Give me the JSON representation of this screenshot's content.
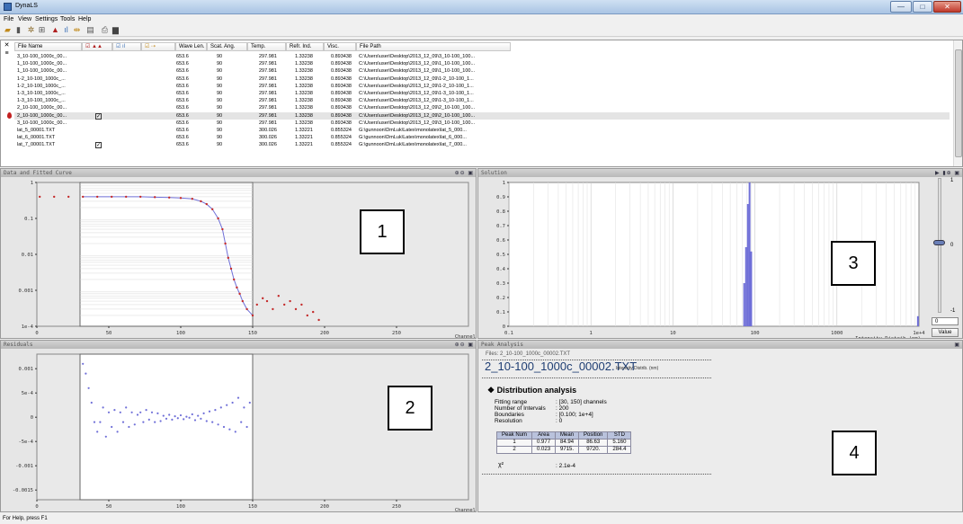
{
  "window": {
    "title": "DynaLS",
    "min": "—",
    "max": "□",
    "close": "✕"
  },
  "menu": [
    "File",
    "View",
    "Settings",
    "Tools",
    "Help"
  ],
  "toolbar_icons": [
    "open-icon",
    "delete-icon",
    "settings-icon",
    "fit-icon",
    "chart-icon",
    "axis-icon",
    "range-icon",
    "document-icon",
    "preview-icon",
    "print-icon"
  ],
  "table": {
    "headers": [
      "File Name",
      "☑ ▲▲",
      "☑ ıl",
      "☑ ⇢",
      "Wave Len.",
      "Scat. Ang.",
      "Temp.",
      "Refr. Ind.",
      "Visc.",
      "File Path"
    ],
    "rows": [
      {
        "name": "3_10-100_1000c_00...",
        "wave": "653.6",
        "angle": "90",
        "temp": "297.981",
        "refr": "1.33238",
        "visc": "0.893438",
        "path": "C:\\Users\\user\\Desktop\\2013_12_09\\3_10-100_100...",
        "checked": false,
        "selected": false,
        "active": false
      },
      {
        "name": "1_10-100_1000c_00...",
        "wave": "653.6",
        "angle": "90",
        "temp": "297.981",
        "refr": "1.33238",
        "visc": "0.893438",
        "path": "C:\\Users\\user\\Desktop\\2013_12_09\\1_10-100_100...",
        "checked": false,
        "selected": false,
        "active": false
      },
      {
        "name": "1_10-100_1000c_00...",
        "wave": "653.6",
        "angle": "90",
        "temp": "297.981",
        "refr": "1.33238",
        "visc": "0.893438",
        "path": "C:\\Users\\user\\Desktop\\2013_12_09\\1_10-100_100...",
        "checked": false,
        "selected": false,
        "active": false
      },
      {
        "name": "1-2_10-100_1000c_...",
        "wave": "653.6",
        "angle": "90",
        "temp": "297.981",
        "refr": "1.33238",
        "visc": "0.893438",
        "path": "C:\\Users\\user\\Desktop\\2013_12_09\\1-2_10-100_1...",
        "checked": false,
        "selected": false,
        "active": false
      },
      {
        "name": "1-2_10-100_1000c_...",
        "wave": "653.6",
        "angle": "90",
        "temp": "297.981",
        "refr": "1.33238",
        "visc": "0.893438",
        "path": "C:\\Users\\user\\Desktop\\2013_12_09\\1-2_10-100_1...",
        "checked": false,
        "selected": false,
        "active": false
      },
      {
        "name": "1-3_10-100_1000c_...",
        "wave": "653.6",
        "angle": "90",
        "temp": "297.981",
        "refr": "1.33238",
        "visc": "0.893438",
        "path": "C:\\Users\\user\\Desktop\\2013_12_09\\1-3_10-100_1...",
        "checked": false,
        "selected": false,
        "active": false
      },
      {
        "name": "1-3_10-100_1000c_...",
        "wave": "653.6",
        "angle": "90",
        "temp": "297.981",
        "refr": "1.33238",
        "visc": "0.893438",
        "path": "C:\\Users\\user\\Desktop\\2013_12_09\\1-3_10-100_1...",
        "checked": false,
        "selected": false,
        "active": false
      },
      {
        "name": "2_10-100_1000c_00...",
        "wave": "653.6",
        "angle": "90",
        "temp": "297.981",
        "refr": "1.33238",
        "visc": "0.893438",
        "path": "C:\\Users\\user\\Desktop\\2013_12_09\\2_10-100_100...",
        "checked": false,
        "selected": false,
        "active": false
      },
      {
        "name": "2_10-100_1000c_00...",
        "wave": "653.6",
        "angle": "90",
        "temp": "297.981",
        "refr": "1.33238",
        "visc": "0.893438",
        "path": "C:\\Users\\user\\Desktop\\2013_12_09\\2_10-100_100...",
        "checked": true,
        "selected": true,
        "active": true
      },
      {
        "name": "3_10-100_1000c_00...",
        "wave": "653.6",
        "angle": "90",
        "temp": "297.981",
        "refr": "1.33238",
        "visc": "0.893438",
        "path": "C:\\Users\\user\\Desktop\\2013_12_09\\3_10-100_100...",
        "checked": false,
        "selected": false,
        "active": false
      },
      {
        "name": "lat_5_00001.TXT",
        "wave": "653.6",
        "angle": "90",
        "temp": "300.026",
        "refr": "1.33221",
        "visc": "0.855324",
        "path": "G:\\gunnoon\\DmLuk\\Latex\\monolatex\\lat_5_000...",
        "checked": false,
        "selected": false,
        "active": false
      },
      {
        "name": "lat_6_00001.TXT",
        "wave": "653.6",
        "angle": "90",
        "temp": "300.026",
        "refr": "1.33221",
        "visc": "0.855324",
        "path": "G:\\gunnoon\\DmLuk\\Latex\\monolatex\\lat_6_000...",
        "checked": false,
        "selected": false,
        "active": false
      },
      {
        "name": "lat_7_00001.TXT",
        "wave": "653.6",
        "angle": "90",
        "temp": "300.026",
        "refr": "1.33221",
        "visc": "0.855324",
        "path": "G:\\gunnoon\\DmLuk\\Latex\\monolatex\\lat_7_000...",
        "checked": true,
        "selected": false,
        "active": false
      }
    ]
  },
  "panels": {
    "fit": {
      "title": "Data and Fitted Curve",
      "number": "1"
    },
    "residuals": {
      "title": "Residuals",
      "number": "2"
    },
    "solution": {
      "title": "Solution",
      "number": "3",
      "value_input": "0",
      "value_button": "Value"
    },
    "peak": {
      "title": "Peak Analysis",
      "number": "4"
    }
  },
  "chart_data": [
    {
      "name": "fit",
      "type": "scatter",
      "xlabel": "Channel",
      "xlim": [
        0,
        300
      ],
      "x_ticks": [
        "0",
        "50",
        "100",
        "150",
        "200",
        "250"
      ],
      "y_ticks": [
        "1",
        "0.1",
        "0.01",
        "0.001",
        "1e-4"
      ],
      "y_scale": "log",
      "ylim": [
        0.0001,
        1
      ],
      "window": [
        30,
        150
      ],
      "points": [
        [
          2,
          0.4
        ],
        [
          12,
          0.4
        ],
        [
          22,
          0.4
        ],
        [
          32,
          0.4
        ],
        [
          42,
          0.4
        ],
        [
          52,
          0.4
        ],
        [
          62,
          0.4
        ],
        [
          72,
          0.4
        ],
        [
          82,
          0.39
        ],
        [
          92,
          0.38
        ],
        [
          100,
          0.37
        ],
        [
          108,
          0.35
        ],
        [
          114,
          0.3
        ],
        [
          118,
          0.25
        ],
        [
          122,
          0.18
        ],
        [
          126,
          0.1
        ],
        [
          129,
          0.05
        ],
        [
          131,
          0.02
        ],
        [
          133,
          0.008
        ],
        [
          135,
          0.004
        ],
        [
          137,
          0.002
        ],
        [
          139,
          0.0012
        ],
        [
          141,
          0.0008
        ],
        [
          143,
          0.0005
        ],
        [
          146,
          0.0003
        ],
        [
          150,
          0.0002
        ],
        [
          153,
          0.0004
        ],
        [
          157,
          0.0006
        ],
        [
          160,
          0.0005
        ],
        [
          164,
          0.0003
        ],
        [
          168,
          0.0007
        ],
        [
          172,
          0.0004
        ],
        [
          176,
          0.0005
        ],
        [
          180,
          0.0003
        ],
        [
          184,
          0.0004
        ],
        [
          188,
          0.0002
        ],
        [
          192,
          0.00025
        ],
        [
          196,
          0.00015
        ]
      ]
    },
    {
      "name": "residuals",
      "type": "scatter",
      "xlabel": "Channel",
      "xlim": [
        0,
        300
      ],
      "x_ticks": [
        "0",
        "50",
        "100",
        "150",
        "200",
        "250"
      ],
      "y_ticks": [
        "0.001",
        "5e-4",
        "0",
        "-5e-4",
        "-0.001",
        "-0.0015"
      ],
      "ylim": [
        -0.0017,
        0.0013
      ],
      "window": [
        30,
        150
      ],
      "points": [
        [
          32,
          0.0011
        ],
        [
          34,
          0.0009
        ],
        [
          36,
          0.0006
        ],
        [
          38,
          0.0003
        ],
        [
          40,
          -0.0001
        ],
        [
          42,
          -0.0003
        ],
        [
          44,
          -0.0001
        ],
        [
          46,
          0.0002
        ],
        [
          48,
          -0.0004
        ],
        [
          50,
          0.0001
        ],
        [
          52,
          -0.0002
        ],
        [
          54,
          0.00015
        ],
        [
          56,
          -0.0003
        ],
        [
          58,
          0.0001
        ],
        [
          60,
          -0.0001
        ],
        [
          62,
          0.0002
        ],
        [
          64,
          -0.0002
        ],
        [
          66,
          0.0001
        ],
        [
          68,
          -0.00015
        ],
        [
          70,
          5e-05
        ],
        [
          72,
          0.0001
        ],
        [
          74,
          -0.0001
        ],
        [
          76,
          0.00015
        ],
        [
          78,
          -5e-05
        ],
        [
          80,
          0.0001
        ],
        [
          82,
          -0.0001
        ],
        [
          84,
          8e-05
        ],
        [
          86,
          -8e-05
        ],
        [
          88,
          3e-05
        ],
        [
          90,
          -3e-05
        ],
        [
          92,
          5e-05
        ],
        [
          94,
          -5e-05
        ],
        [
          96,
          2e-05
        ],
        [
          98,
          -2e-05
        ],
        [
          100,
          4e-05
        ],
        [
          102,
          -4e-05
        ],
        [
          104,
          1e-05
        ],
        [
          106,
          -1e-05
        ],
        [
          108,
          6e-05
        ],
        [
          110,
          -6e-05
        ],
        [
          112,
          3e-05
        ],
        [
          114,
          -3e-05
        ],
        [
          116,
          8e-05
        ],
        [
          118,
          -8e-05
        ],
        [
          120,
          0.00012
        ],
        [
          122,
          -0.0001
        ],
        [
          124,
          0.00015
        ],
        [
          126,
          -0.00015
        ],
        [
          128,
          0.0002
        ],
        [
          130,
          -0.0002
        ],
        [
          132,
          0.00025
        ],
        [
          134,
          -0.00025
        ],
        [
          136,
          0.0003
        ],
        [
          138,
          -0.0003
        ],
        [
          140,
          0.0004
        ],
        [
          142,
          -0.0001
        ],
        [
          144,
          0.0002
        ],
        [
          146,
          -0.0002
        ],
        [
          148,
          0.0003
        ]
      ]
    },
    {
      "name": "solution",
      "type": "bar",
      "xlabel": "Intensity Distrib (nm)",
      "x_scale": "log",
      "xlim": [
        0.1,
        10000
      ],
      "x_ticks": [
        "0.1",
        "1",
        "10",
        "100",
        "1000",
        "1e+4"
      ],
      "y_ticks": [
        "0",
        "0.1",
        "0.2",
        "0.3",
        "0.4",
        "0.5",
        "0.6",
        "0.7",
        "0.8",
        "0.9",
        "1"
      ],
      "ylim": [
        0,
        1
      ],
      "bars": [
        [
          74,
          0.3
        ],
        [
          78,
          0.55
        ],
        [
          82,
          0.85
        ],
        [
          86,
          1.0
        ],
        [
          90,
          0.52
        ],
        [
          9720,
          0.07
        ]
      ],
      "slider_ticks": [
        "1",
        "0",
        "-1"
      ],
      "slider_value": 0
    }
  ],
  "peak_analysis": {
    "files_label": "Files: 2_10-100_1000c_00002.TXT",
    "title": "2_10-100_1000c_00002.TXT",
    "subtitle": "Intensity Distrib. (nm)",
    "section": "❖ Distribution analysis",
    "params": [
      {
        "label": "Fitting range",
        "value": ": [30, 150] channels"
      },
      {
        "label": "Number of Intervals",
        "value": ": 200"
      },
      {
        "label": "Boundaries",
        "value": ": [0.100; 1e+4]"
      },
      {
        "label": "Resolution",
        "value": ": 0"
      }
    ],
    "table_headers": [
      "Peak Num",
      "Area",
      "Mean",
      "Position",
      "STD"
    ],
    "table_rows": [
      [
        "1",
        "0.977",
        "84.94",
        "86.63",
        "5.160"
      ],
      [
        "2",
        "0.023",
        "9715.",
        "9720.",
        "284.4"
      ]
    ],
    "chi_label": "χ²",
    "chi_value": ": 2.1e-4"
  },
  "status": "For Help, press F1"
}
